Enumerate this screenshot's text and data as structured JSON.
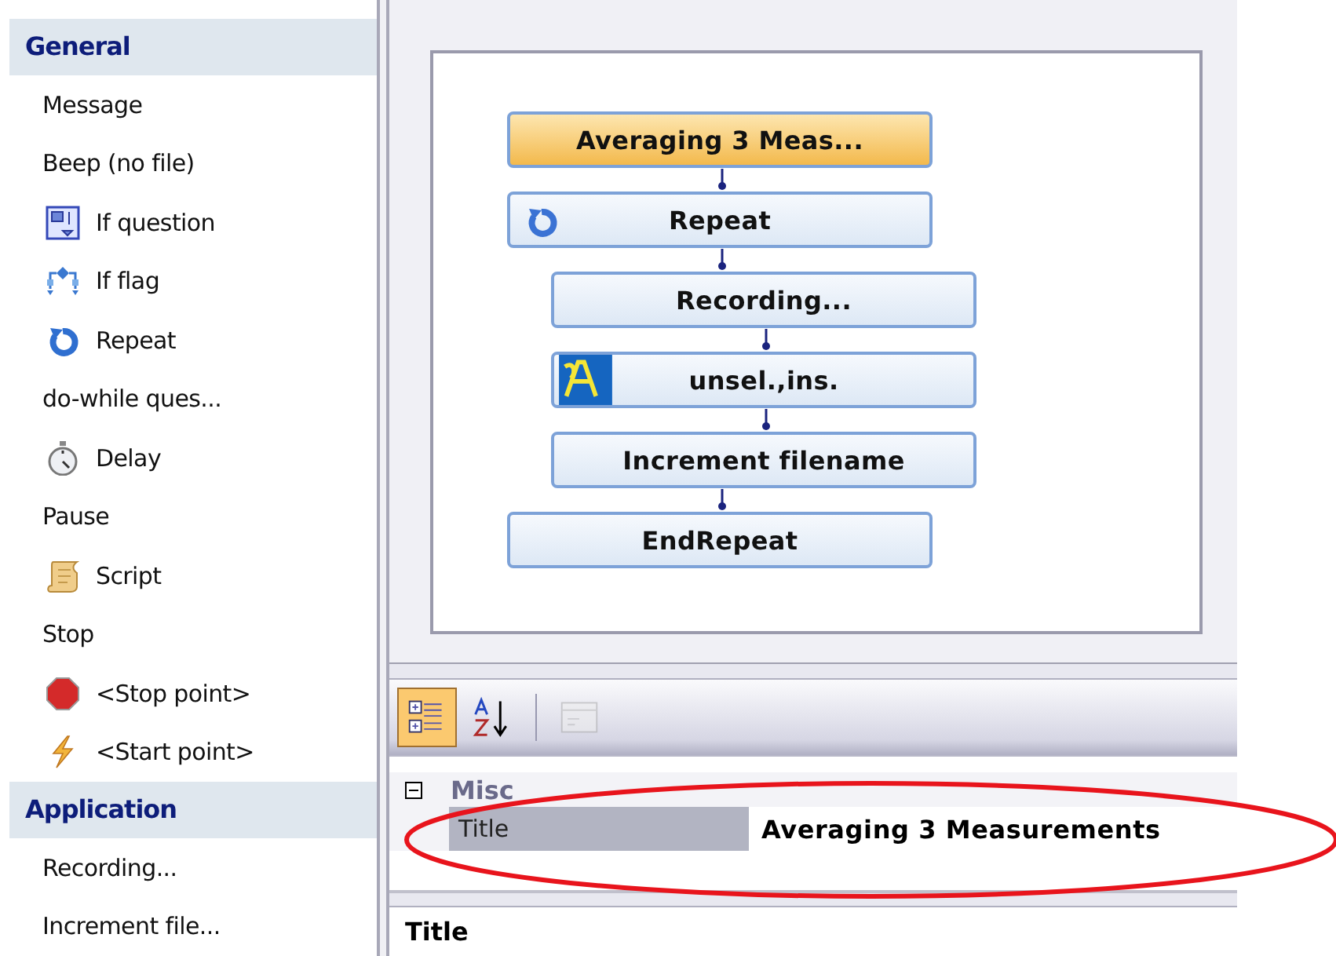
{
  "toolbox": {
    "groups": [
      {
        "title": "General",
        "items": [
          {
            "label": "Message",
            "kind": "plain"
          },
          {
            "label": "Beep (no file)",
            "kind": "plain"
          },
          {
            "label": "If question",
            "kind": "question"
          },
          {
            "label": "If flag",
            "kind": "flag"
          },
          {
            "label": "Repeat",
            "kind": "repeat"
          },
          {
            "label": "do-while ques...",
            "kind": "plain"
          },
          {
            "label": "Delay",
            "kind": "delay"
          },
          {
            "label": "Pause",
            "kind": "plain"
          },
          {
            "label": "Script",
            "kind": "script"
          },
          {
            "label": "Stop",
            "kind": "plain"
          },
          {
            "label": "<Stop point>",
            "kind": "stop"
          },
          {
            "label": "<Start point>",
            "kind": "start"
          }
        ]
      },
      {
        "title": "Application",
        "items": [
          {
            "label": "Recording...",
            "kind": "plain"
          },
          {
            "label": "Increment file...",
            "kind": "plain"
          }
        ]
      }
    ]
  },
  "flow": {
    "nodes": [
      {
        "label": "Averaging 3 Meas...",
        "kind": "plain",
        "selected": true
      },
      {
        "label": "Repeat",
        "kind": "repeat",
        "selected": false,
        "children": [
          {
            "label": "Recording...",
            "kind": "plain",
            "selected": false
          },
          {
            "label": "unsel.,ins.",
            "kind": "text",
            "selected": false
          },
          {
            "label": "Increment filename",
            "kind": "plain",
            "selected": false
          }
        ]
      },
      {
        "label": "EndRepeat",
        "kind": "plain",
        "selected": false
      }
    ]
  },
  "properties": {
    "toolbar": [
      {
        "kind": "categorized",
        "selected": true
      },
      {
        "kind": "alphabetical",
        "selected": false
      },
      {
        "kind": "pages",
        "selected": false,
        "disabled": true
      }
    ],
    "category": {
      "label": "Misc",
      "expanded": true
    },
    "rows": [
      {
        "name": "Title",
        "value": "Averaging 3 Measurements",
        "selected": true
      }
    ],
    "description": {
      "title": "Title"
    }
  }
}
